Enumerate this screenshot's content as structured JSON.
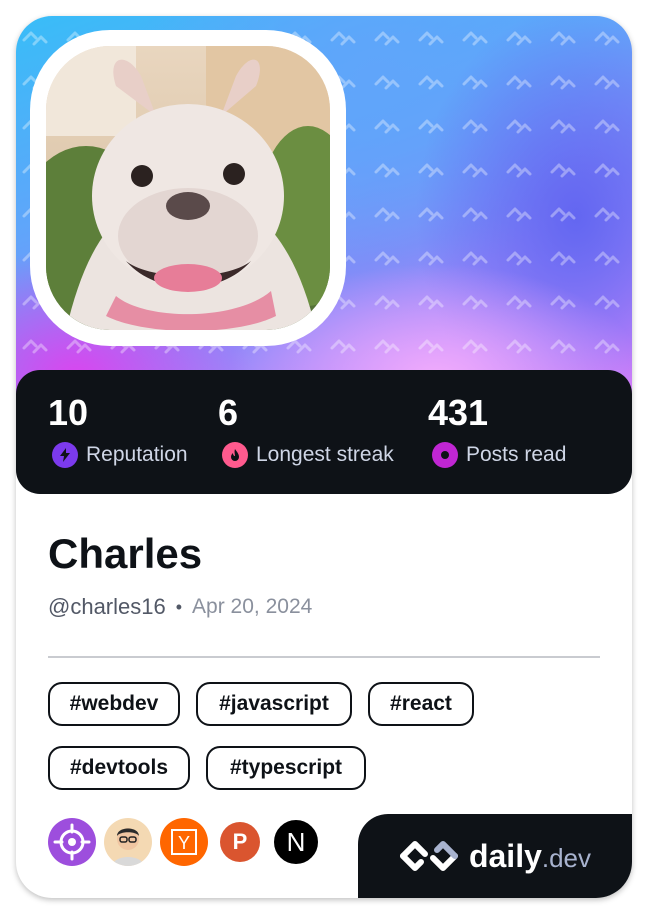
{
  "profile": {
    "name": "Charles",
    "handle": "@charles16",
    "separator": "•",
    "joined": "Apr 20, 2024"
  },
  "stats": [
    {
      "value": "10",
      "label": "Reputation",
      "icon": "lightning-icon",
      "color": "#7c3aed"
    },
    {
      "value": "6",
      "label": "Longest streak",
      "icon": "flame-icon",
      "color": "#ff5a8e"
    },
    {
      "value": "431",
      "label": "Posts read",
      "icon": "eye-icon",
      "color": "#c026d3"
    }
  ],
  "tags": [
    "#webdev",
    "#javascript",
    "#react",
    "#devtools",
    "#typescript"
  ],
  "squads": [
    {
      "icon": "crosshair-squad-icon",
      "color": "#9d4edd"
    },
    {
      "icon": "developer-avatar-squad-icon",
      "color": "#f4d9b3"
    },
    {
      "icon": "y-combinator-icon",
      "color": "#ff6600",
      "letter": "Y"
    },
    {
      "icon": "product-hunt-icon",
      "color": "#da552f",
      "letter": "P"
    },
    {
      "icon": "nextjs-icon",
      "color": "#000000",
      "letter": "N"
    }
  ],
  "brand": {
    "name": "daily",
    "suffix": ".dev",
    "icon": "daily-dev-logo-icon"
  },
  "colors": {
    "card_dark": "#0e1217",
    "accent_purple": "#7c3aed",
    "accent_pink": "#ff5a8e",
    "accent_magenta": "#c026d3"
  }
}
